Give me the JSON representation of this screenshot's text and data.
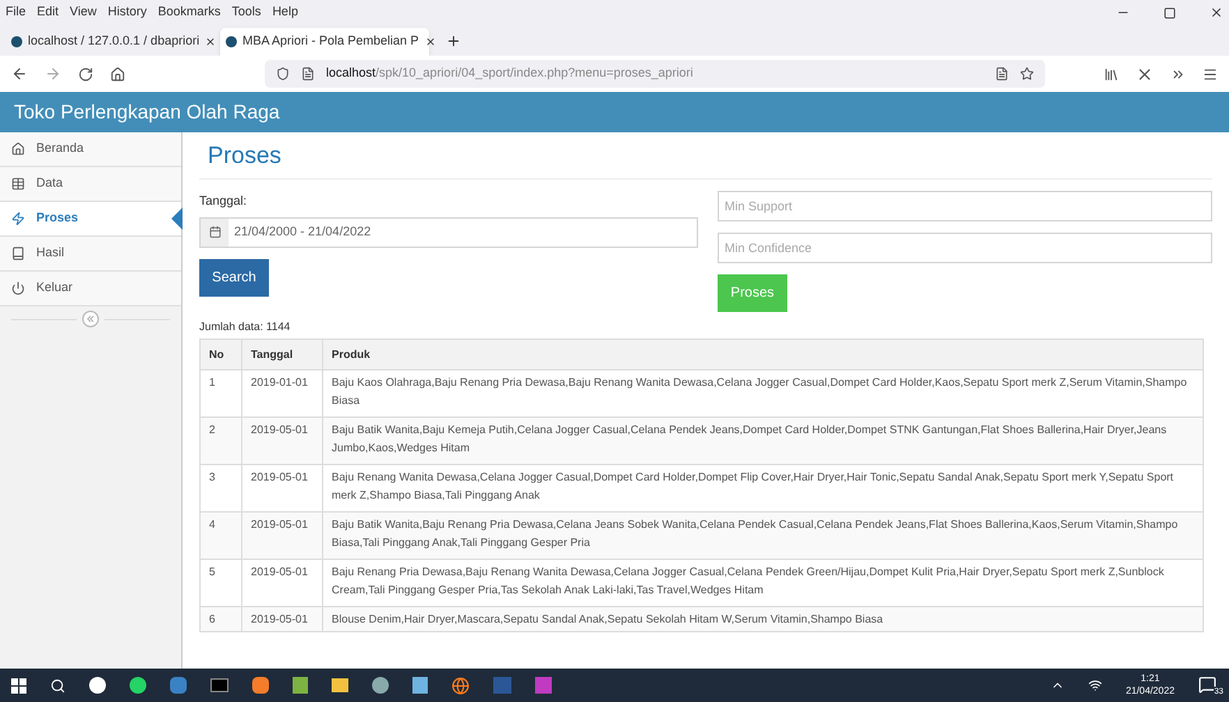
{
  "menu_bar": [
    "File",
    "Edit",
    "View",
    "History",
    "Bookmarks",
    "Tools",
    "Help"
  ],
  "tabs": [
    {
      "label": "localhost / 127.0.0.1 / dbapriori",
      "selected": false
    },
    {
      "label": "MBA Apriori - Pola Pembelian P",
      "selected": true
    }
  ],
  "address": {
    "host": "localhost",
    "path": "/spk/10_apriori/04_sport/index.php?menu=proses_apriori"
  },
  "app_title": "Toko Perlengkapan Olah Raga",
  "sidebar": [
    {
      "label": "Beranda",
      "selected": false
    },
    {
      "label": "Data",
      "selected": false
    },
    {
      "label": "Proses",
      "selected": true
    },
    {
      "label": "Hasil",
      "selected": false
    },
    {
      "label": "Keluar",
      "selected": false
    }
  ],
  "page_title": "Proses",
  "form": {
    "date_label": "Tanggal:",
    "date_value": "21/04/2000 - 21/04/2022",
    "search_button": "Search",
    "min_support": {
      "placeholder": "Min Support"
    },
    "min_confidence": {
      "placeholder": "Min Confidence"
    },
    "process_button": "Proses"
  },
  "count": "Jumlah data: 1144",
  "table": {
    "columns": [
      "No",
      "Tanggal",
      "Produk"
    ],
    "rows": [
      [
        "1",
        "2019-01-01",
        "Baju Kaos Olahraga,Baju Renang Pria Dewasa,Baju Renang Wanita Dewasa,Celana Jogger Casual,Dompet Card Holder,Kaos,Sepatu Sport merk Z,Serum Vitamin,Shampo Biasa"
      ],
      [
        "2",
        "2019-05-01",
        "Baju Batik Wanita,Baju Kemeja Putih,Celana Jogger Casual,Celana Pendek Jeans,Dompet Card Holder,Dompet STNK Gantungan,Flat Shoes Ballerina,Hair Dryer,Jeans Jumbo,Kaos,Wedges Hitam"
      ],
      [
        "3",
        "2019-05-01",
        "Baju Renang Wanita Dewasa,Celana Jogger Casual,Dompet Card Holder,Dompet Flip Cover,Hair Dryer,Hair Tonic,Sepatu Sandal Anak,Sepatu Sport merk Y,Sepatu Sport merk Z,Shampo Biasa,Tali Pinggang Anak"
      ],
      [
        "4",
        "2019-05-01",
        "Baju Batik Wanita,Baju Renang Pria Dewasa,Celana Jeans Sobek Wanita,Celana Pendek Casual,Celana Pendek Jeans,Flat Shoes Ballerina,Kaos,Serum Vitamin,Shampo Biasa,Tali Pinggang Anak,Tali Pinggang Gesper Pria"
      ],
      [
        "5",
        "2019-05-01",
        "Baju Renang Pria Dewasa,Baju Renang Wanita Dewasa,Celana Jogger Casual,Celana Pendek Green/Hijau,Dompet Kulit Pria,Hair Dryer,Sepatu Sport merk Z,Sunblock Cream,Tali Pinggang Gesper Pria,Tas Sekolah Anak Laki-laki,Tas Travel,Wedges Hitam"
      ],
      [
        "6",
        "2019-05-01",
        "Blouse Denim,Hair Dryer,Mascara,Sepatu Sandal Anak,Sepatu Sekolah Hitam W,Serum Vitamin,Shampo Biasa"
      ]
    ]
  },
  "taskbar": {
    "time": "1:21",
    "date": "21/04/2022",
    "notifications": "33"
  }
}
